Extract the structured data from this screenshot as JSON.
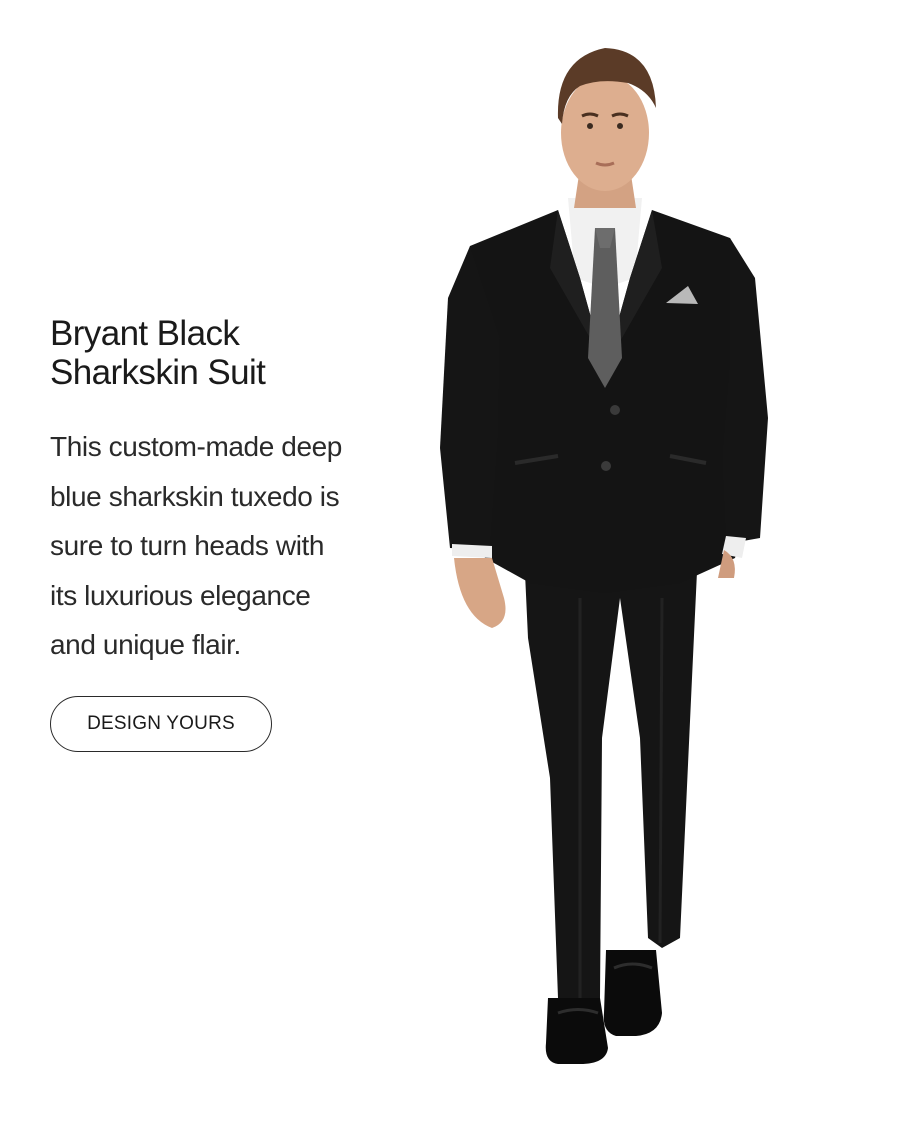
{
  "product": {
    "title": "Bryant Black Sharkskin Suit",
    "description": "This custom-made deep blue sharkskin tuxedo is sure to turn heads with its luxurious elegance and unique flair.",
    "cta_label": "DESIGN YOURS"
  },
  "image": {
    "subject": "model-wearing-black-suit",
    "colors": {
      "suit": "#141414",
      "shirt": "#f2f2f2",
      "tie": "#5a5a5a",
      "skin": "#d9a98a",
      "hair": "#5a3a26",
      "shoes": "#0a0a0a"
    }
  }
}
